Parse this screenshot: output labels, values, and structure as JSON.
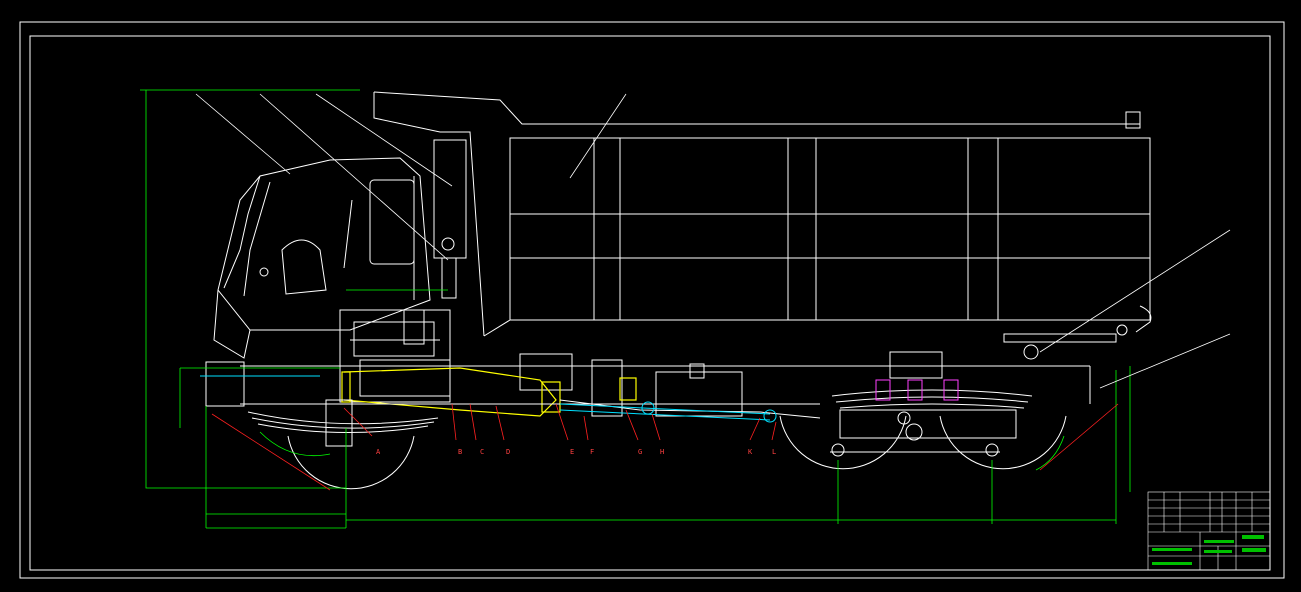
{
  "drawing": {
    "section_labels": [
      "A",
      "B",
      "C",
      "D",
      "E",
      "F",
      "G",
      "H",
      "K",
      "L"
    ],
    "colors": {
      "background": "#000000",
      "outline": "#ffffff",
      "dimension": "#00ff00",
      "leader": "#ff2020",
      "highlight": "#ffff00",
      "accent": "#00e0ff",
      "magenta": "#ff40ff",
      "titleblock_fill": "#00c000"
    }
  }
}
